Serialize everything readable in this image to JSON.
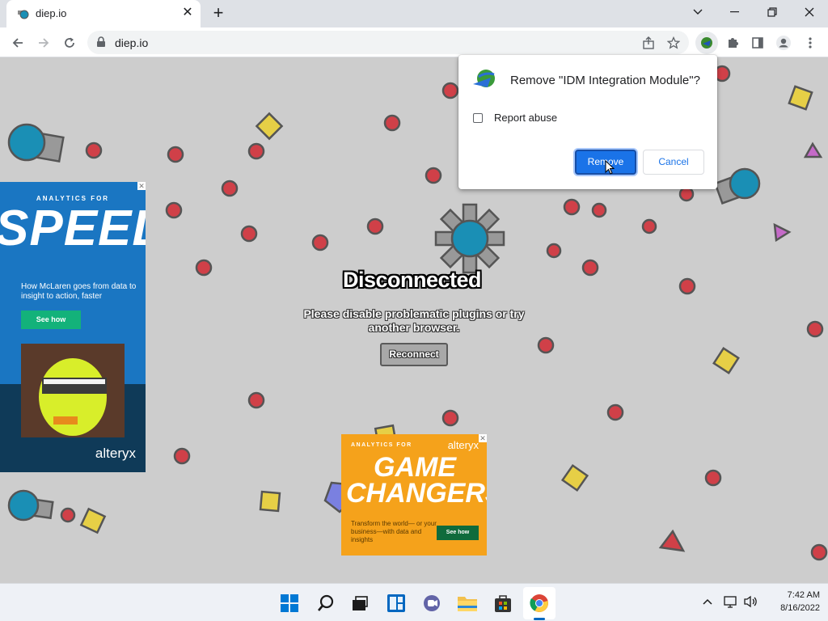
{
  "browser": {
    "tab_title": "diep.io",
    "tab_close": "✕",
    "new_tab": "+",
    "url": "diep.io"
  },
  "game": {
    "title": "Disconnected",
    "message": "Please disable problematic plugins or try another browser.",
    "reconnect_label": "Reconnect"
  },
  "ads": {
    "left": {
      "eyebrow": "ANALYTICS FOR",
      "headline": "SPEED",
      "body": "How McLaren goes from data to insight to action, faster",
      "cta": "See how",
      "brand": "alteryx",
      "close": "✕"
    },
    "bottom": {
      "eyebrow": "ANALYTICS FOR",
      "brand": "alteryx",
      "headline_1": "GAME",
      "headline_2": "CHANGERS",
      "body": "Transform the world— or your business—with data and insights",
      "cta": "See how",
      "close": "✕"
    }
  },
  "dialog": {
    "title": "Remove \"IDM Integration Module\"?",
    "checkbox_label": "Report abuse",
    "remove_label": "Remove",
    "cancel_label": "Cancel",
    "checked": false
  },
  "taskbar": {
    "time": "7:42 AM",
    "date": "8/16/2022"
  },
  "colors": {
    "accent": "#1a73e8",
    "game_bg": "#cdcdcd",
    "polygon_red": "#d04048",
    "polygon_yellow": "#e6cf46",
    "tank_blue": "#1a8fb5"
  }
}
